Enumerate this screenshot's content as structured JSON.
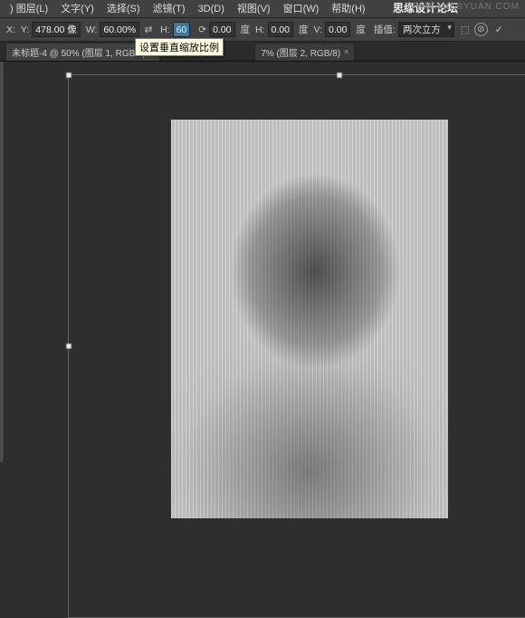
{
  "watermark": "WWW.MISSYUAN.COM",
  "brand": "思缘设计论坛",
  "menu": {
    "layer": ") 图层(L)",
    "type": "文字(Y)",
    "select": "选择(S)",
    "filter": "滤镜(T)",
    "view3d": "3D(D)",
    "view": "视图(V)",
    "window": "窗口(W)",
    "help": "帮助(H)"
  },
  "options": {
    "x_label": "X:",
    "y_label": "Y:",
    "y_value": "478.00 像",
    "w_label": "W:",
    "w_value": "60.00%",
    "h_label": "H:",
    "h_value": "60",
    "h2_label": "H:",
    "h2_value": "0.00",
    "deg1": "度",
    "hh_label": "H:",
    "hh_value": "0.00",
    "deg2": "度",
    "v_label": "V:",
    "v_value": "0.00",
    "deg3": "度",
    "interp_label": "插值:",
    "interp_value": "两次立方",
    "rotate_value": "0.00"
  },
  "tooltip": "设置垂直缩放比例",
  "tabs": {
    "t1": "未标题-4 @ 50% (图层 1, RGB/8)",
    "t2_suffix": "7% (图层 2, RGB/8)",
    "close": "×"
  }
}
